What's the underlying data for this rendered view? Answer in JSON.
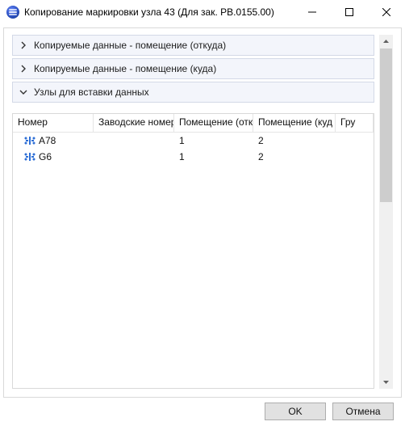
{
  "window": {
    "title": "Копирование маркировки узла 43 (Для зак. РВ.0155.00)"
  },
  "sections": {
    "src": {
      "label": "Копируемые данные - помещение (откуда)",
      "expanded": false
    },
    "dst": {
      "label": "Копируемые данные - помещение (куда)",
      "expanded": false
    },
    "nodes": {
      "label": "Узлы для вставки данных",
      "expanded": true
    }
  },
  "table": {
    "headers": {
      "number": "Номер",
      "factory": "Заводские номер",
      "room_from": "Помещение (отк",
      "room_to": "Помещение (куд",
      "group": "Гру"
    },
    "rows": [
      {
        "number": "A78",
        "factory": "",
        "room_from": "1",
        "room_to": "2",
        "group": ""
      },
      {
        "number": "G6",
        "factory": "",
        "room_from": "1",
        "room_to": "2",
        "group": ""
      }
    ]
  },
  "buttons": {
    "ok": "OK",
    "cancel": "Отмена"
  }
}
